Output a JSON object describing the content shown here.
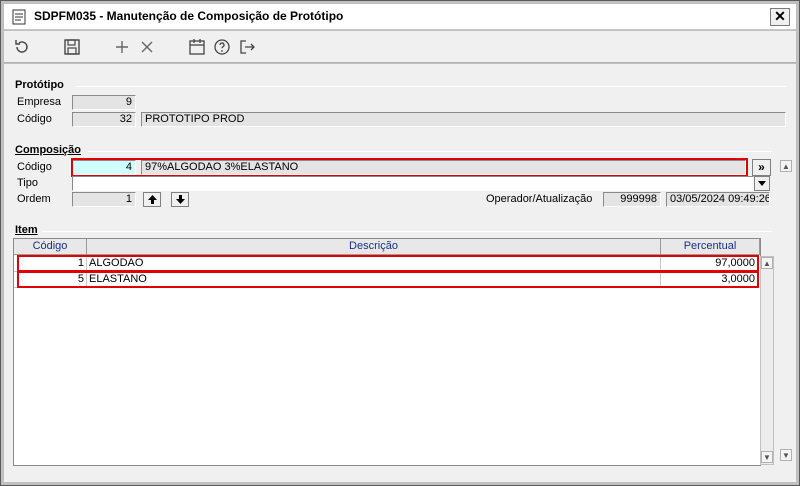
{
  "window": {
    "title": "SDPFM035 - Manutenção de Composição de Protótipo",
    "close_label": "✕"
  },
  "toolbar": {
    "buttons": [
      {
        "name": "refresh-icon"
      },
      {
        "name": "save-icon"
      },
      {
        "name": "add-icon"
      },
      {
        "name": "delete-icon"
      },
      {
        "name": "calendar-icon"
      },
      {
        "name": "help-icon"
      },
      {
        "name": "exit-icon"
      }
    ]
  },
  "prototipo": {
    "title": "Protótipo",
    "empresa_label": "Empresa",
    "empresa_value": "9",
    "codigo_label": "Código",
    "codigo_value": "32",
    "descricao_value": "PROTOTIPO PROD"
  },
  "composicao": {
    "title": "Composição",
    "codigo_label": "Código",
    "codigo_value": "4",
    "descricao_value": "97%ALGODAO 3%ELASTANO",
    "lookup_label": "»",
    "tipo_label": "Tipo",
    "tipo_value": "",
    "ordem_label": "Ordem",
    "ordem_value": "1",
    "up_label": "🡅",
    "down_label": "🡇",
    "operador_label": "Operador/Atualização",
    "operador_value": "999998",
    "atualizacao_value": "03/05/2024 09:49:26"
  },
  "item": {
    "title": "Item",
    "columns": [
      "Código",
      "Descrição",
      "Percentual"
    ],
    "rows": [
      {
        "codigo": "1",
        "descricao": "ALGODAO",
        "percentual": "97,0000"
      },
      {
        "codigo": "5",
        "descricao": "ELASTANO",
        "percentual": "3,0000"
      }
    ]
  },
  "colors": {
    "highlight": "#e00000",
    "header_text": "#1a2f8a",
    "cyan_field": "#cfffff"
  }
}
